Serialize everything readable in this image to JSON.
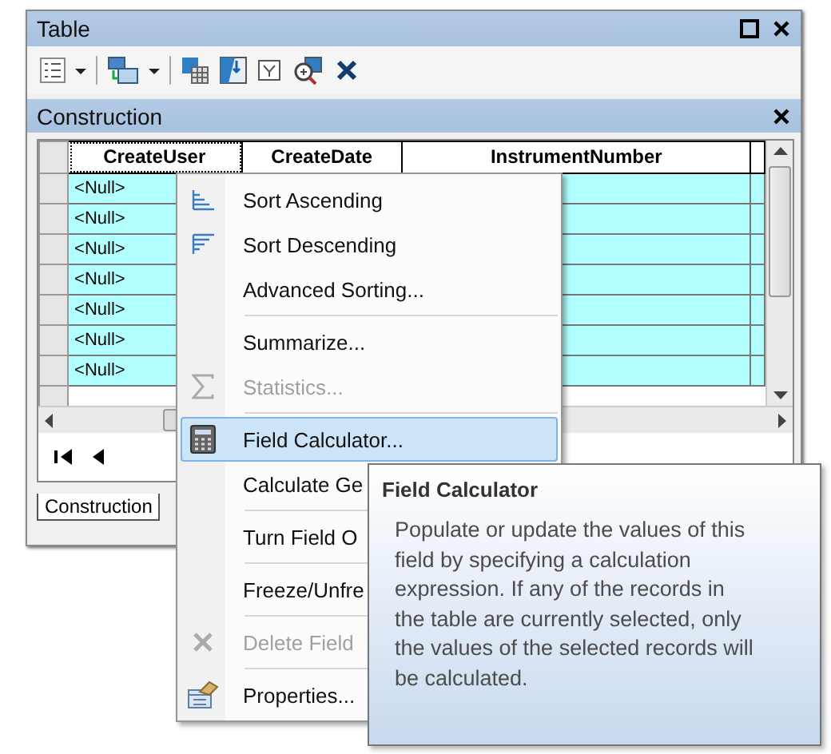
{
  "window": {
    "title": "Table"
  },
  "table": {
    "title": "Construction",
    "columns": [
      "CreateUser",
      "CreateDate",
      "InstrumentNumber"
    ],
    "rows": [
      {
        "create_user": "<Null>",
        "selected": true
      },
      {
        "create_user": "<Null>",
        "selected": true
      },
      {
        "create_user": "<Null>",
        "selected": true
      },
      {
        "create_user": "<Null>",
        "selected": true
      },
      {
        "create_user": "<Null>",
        "selected": true
      },
      {
        "create_user": "<Null>",
        "selected": true
      },
      {
        "create_user": "<Null>",
        "selected": true
      }
    ]
  },
  "tab": "Construction",
  "context_menu": [
    {
      "kind": "sort-asc",
      "label": "Sort Ascending",
      "disabled": false,
      "selected": false
    },
    {
      "kind": "sort-desc",
      "label": "Sort Descending",
      "disabled": false,
      "selected": false
    },
    {
      "kind": "plain",
      "label": "Advanced Sorting...",
      "disabled": false,
      "selected": false
    },
    {
      "kind": "separator"
    },
    {
      "kind": "plain",
      "label": "Summarize...",
      "disabled": false,
      "selected": false
    },
    {
      "kind": "sigma",
      "label": "Statistics...",
      "disabled": true,
      "selected": false
    },
    {
      "kind": "separator"
    },
    {
      "kind": "calculator",
      "label": "Field Calculator...",
      "disabled": false,
      "selected": true
    },
    {
      "kind": "plain",
      "label": "Calculate Ge",
      "disabled": false,
      "selected": false
    },
    {
      "kind": "separator"
    },
    {
      "kind": "plain",
      "label": "Turn Field O",
      "disabled": false,
      "selected": false
    },
    {
      "kind": "separator"
    },
    {
      "kind": "plain",
      "label": "Freeze/Unfre",
      "disabled": false,
      "selected": false
    },
    {
      "kind": "separator"
    },
    {
      "kind": "delete",
      "label": "Delete Field",
      "disabled": true,
      "selected": false
    },
    {
      "kind": "separator"
    },
    {
      "kind": "properties",
      "label": "Properties...",
      "disabled": false,
      "selected": false
    }
  ],
  "tooltip": {
    "title": "Field Calculator",
    "text": "Populate or update the values of this field by specifying a calculation expression. If any of the records in the table are currently selected, only the values of the selected records will be calculated."
  }
}
